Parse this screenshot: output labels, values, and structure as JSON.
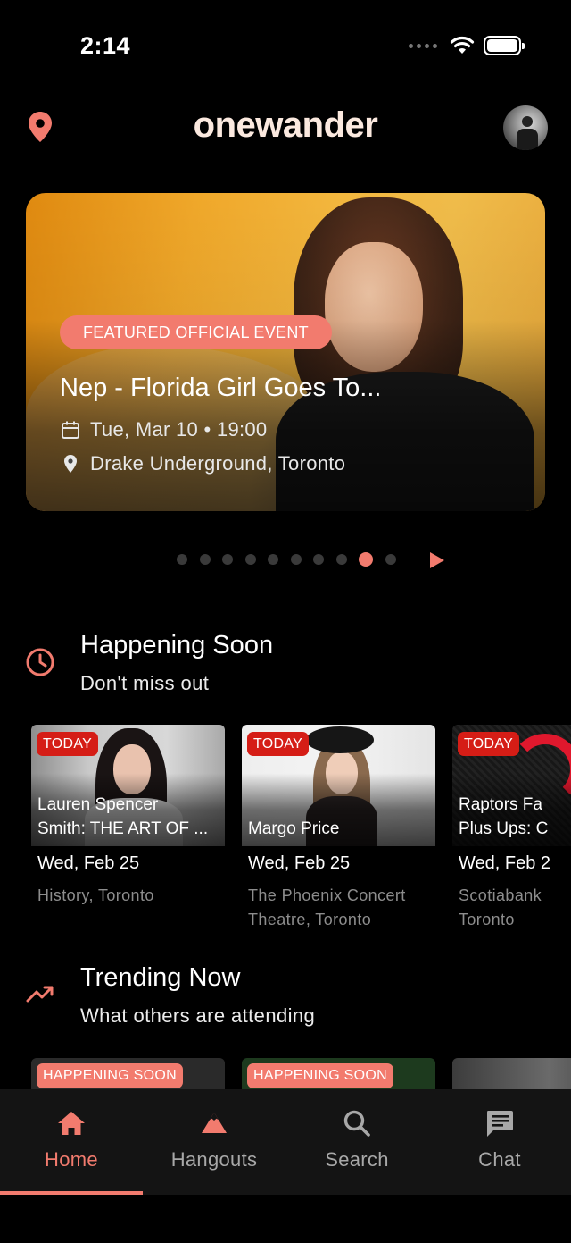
{
  "status_bar": {
    "time": "2:14",
    "icons": [
      "signal-dots-icon",
      "wifi-icon",
      "battery-icon"
    ]
  },
  "header": {
    "logo": "onewander",
    "left_icon": "location-pin-icon",
    "right_icon": "avatar"
  },
  "featured": {
    "badge": "FEATURED OFFICIAL EVENT",
    "title": "Nep - Florida Girl Goes To...",
    "datetime": "Tue, Mar 10 • 19:00",
    "venue": "Drake Underground, Toronto"
  },
  "carousel": {
    "total_slides": 10,
    "active_index": 8
  },
  "happening_soon": {
    "title": "Happening Soon",
    "subtitle": "Don't miss out",
    "events": [
      {
        "badge": "TODAY",
        "title_line1": "Lauren Spencer",
        "title_line2": "Smith: THE ART OF ...",
        "date": "Wed, Feb 25",
        "venue_line1": "History, Toronto",
        "venue_line2": ""
      },
      {
        "badge": "TODAY",
        "title_line1": "",
        "title_line2": "Margo Price",
        "date": "Wed, Feb 25",
        "venue_line1": "The Phoenix Concert",
        "venue_line2": "Theatre, Toronto"
      },
      {
        "badge": "TODAY",
        "title_line1": "Raptors Fa",
        "title_line2": "Plus Ups: C",
        "date": "Wed, Feb 2",
        "venue_line1": "Scotiabank",
        "venue_line2": "Toronto"
      }
    ]
  },
  "trending_now": {
    "title": "Trending Now",
    "subtitle": "What others are attending",
    "cards": [
      {
        "badge": "HAPPENING SOON"
      },
      {
        "badge": "HAPPENING SOON"
      },
      {
        "badge": ""
      }
    ]
  },
  "tab_bar": {
    "tabs": [
      {
        "label": "Home",
        "icon": "home-icon",
        "active": true
      },
      {
        "label": "Hangouts",
        "icon": "mountain-icon",
        "active": false
      },
      {
        "label": "Search",
        "icon": "search-icon",
        "active": false
      },
      {
        "label": "Chat",
        "icon": "chat-icon",
        "active": false
      }
    ]
  },
  "colors": {
    "accent": "#f27b6e",
    "today_badge": "#d51d16",
    "background": "#000000",
    "tab_bar": "#141414",
    "logo": "#fbe9df"
  }
}
